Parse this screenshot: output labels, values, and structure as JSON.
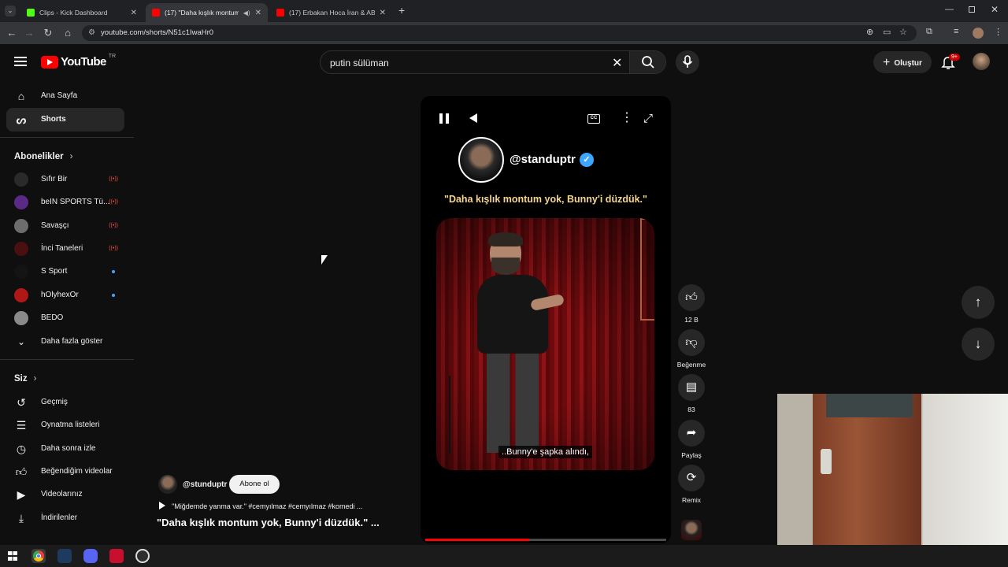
{
  "browser": {
    "tabs": [
      {
        "title": "Clips - Kick Dashboard",
        "favicon_color": "#53fc18"
      },
      {
        "title": "(17) \"Daha kışlık montum y",
        "favicon_color": "#ff0000"
      },
      {
        "title": "(17) Erbakan Hoca İran & ABD",
        "favicon_color": "#ff0000"
      }
    ],
    "url": "youtube.com/shorts/N51c1IwaHr0"
  },
  "youtube": {
    "logo_text": "YouTube",
    "country_code": "TR",
    "search_query": "putin sülüman",
    "create_label": "Oluştur",
    "notification_count": "9+"
  },
  "sidebar": {
    "main": [
      {
        "label": "Ana Sayfa",
        "icon": "home-icon"
      },
      {
        "label": "Shorts",
        "icon": "shorts-icon"
      }
    ],
    "subscriptions_title": "Abonelikler",
    "subscriptions": [
      {
        "label": "Sıfır Bir",
        "status": "live",
        "color": "#2a2a2a"
      },
      {
        "label": "beIN SPORTS Tü...",
        "status": "live",
        "color": "#5b2a86"
      },
      {
        "label": "Savaşçı",
        "status": "live",
        "color": "#6d6d6d"
      },
      {
        "label": "İnci Taneleri",
        "status": "live",
        "color": "#4a1010"
      },
      {
        "label": "S Sport",
        "status": "new",
        "color": "#141414"
      },
      {
        "label": "hOlyhexOr",
        "status": "new",
        "color": "#b01818"
      },
      {
        "label": "BEDO",
        "status": "none",
        "color": "#8a8a8a"
      }
    ],
    "show_more_label": "Daha fazla göster",
    "you_title": "Siz",
    "you_items": [
      {
        "label": "Geçmiş",
        "icon": "history-icon"
      },
      {
        "label": "Oynatma listeleri",
        "icon": "playlists-icon"
      },
      {
        "label": "Daha sonra izle",
        "icon": "watch-later-icon"
      },
      {
        "label": "Beğendiğim videolar",
        "icon": "liked-icon"
      },
      {
        "label": "Videolarınız",
        "icon": "your-videos-icon"
      },
      {
        "label": "İndirilenler",
        "icon": "downloads-icon"
      }
    ]
  },
  "short": {
    "channel_handle": "@standuptr",
    "overlay_quote": "\"Daha kışlık montum yok, Bunny'i düzdük.\"",
    "subtitle": "..Bunny'e şapka alındı,",
    "progress": 0.43
  },
  "actions": {
    "likes": "12 B",
    "dislike_label": "Beğenme",
    "comments": "83",
    "share_label": "Paylaş",
    "remix_label": "Remix"
  },
  "meta": {
    "owner_handle": "@stunduptr",
    "subscribe_label": "Abone ol",
    "tags_line": "\"Miğdemde yanma var.\" #cemyılmaz #cemyılmaz #komedi ...",
    "title": "\"Daha kışlık montum yok, Bunny'i düzdük.\"  ..."
  },
  "colors": {
    "background": "#0f0f0f",
    "accent_red": "#ff0000",
    "quote_yellow": "#f6d58c",
    "verified_blue": "#3ea6ff"
  }
}
